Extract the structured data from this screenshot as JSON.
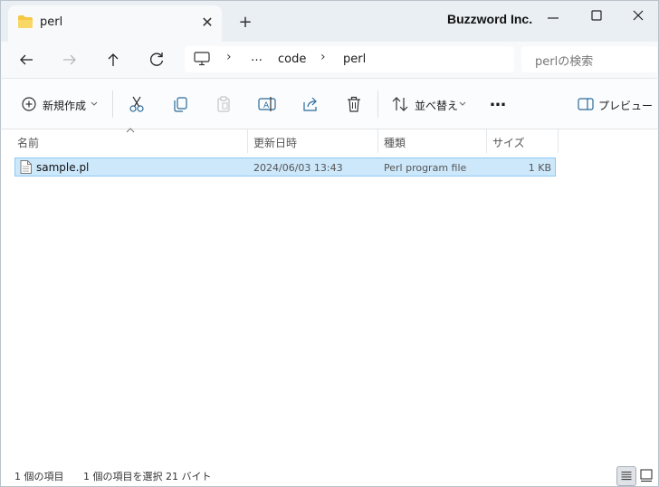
{
  "tab": {
    "title": "perl",
    "close_label": "✕",
    "new_tab_label": "+"
  },
  "brand": "Buzzword Inc.",
  "window_controls": {
    "minimize": "minimize-icon",
    "maximize": "maximize-icon",
    "close": "close-icon"
  },
  "nav": {
    "back": "back-arrow-icon",
    "forward": "forward-arrow-icon",
    "up": "up-arrow-icon",
    "refresh": "refresh-icon"
  },
  "address": {
    "root_icon": "computer-icon",
    "crumbs": [
      "…",
      "code",
      "perl"
    ],
    "separator": "›"
  },
  "search": {
    "placeholder": "perlの検索"
  },
  "commands": {
    "new_label": "新規作成",
    "sort_label": "並べ替え",
    "more_label": "…",
    "preview_label": "プレビュー",
    "icons": [
      "new-icon",
      "cut-icon",
      "copy-icon",
      "paste-icon",
      "rename-icon",
      "share-icon",
      "delete-icon",
      "sort-icon",
      "more-icon",
      "preview-pane-icon"
    ]
  },
  "columns": [
    "名前",
    "更新日時",
    "種類",
    "サイズ"
  ],
  "files": [
    {
      "name": "sample.pl",
      "modified": "2024/06/03 13:43",
      "type": "Perl program file",
      "size": "1 KB",
      "selected": true
    }
  ],
  "status": {
    "count": "1 個の項目",
    "selection": "1 個の項目を選択  21 バイト"
  },
  "colors": {
    "selection_bg": "#cde8fb",
    "selection_border": "#8ec8f2",
    "accent": "#0067c0"
  }
}
